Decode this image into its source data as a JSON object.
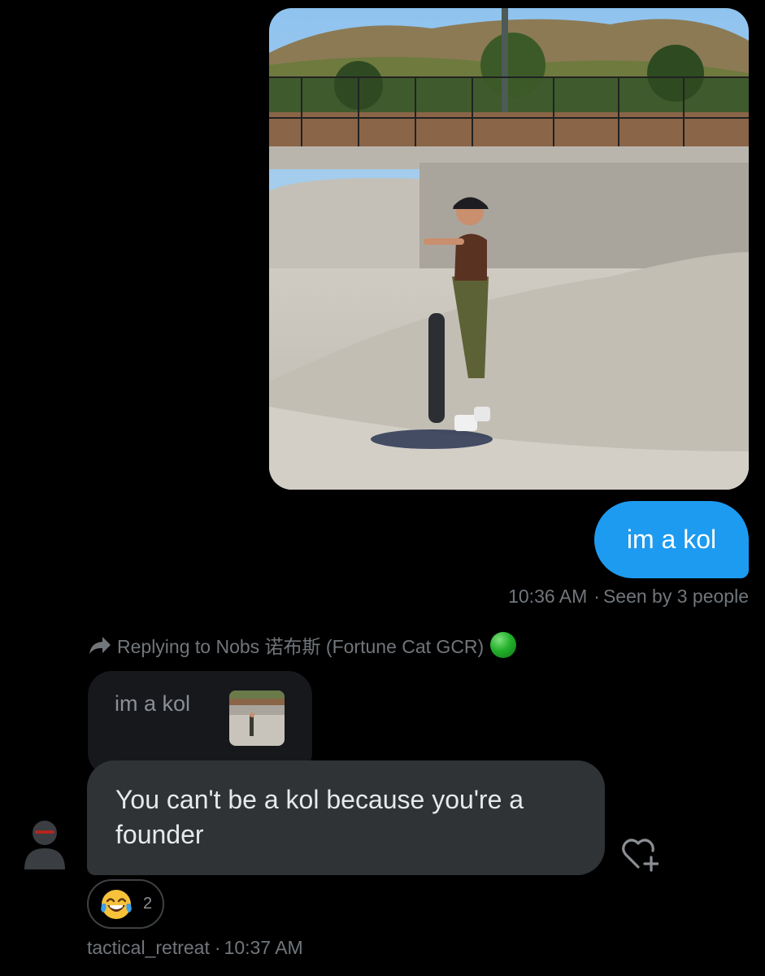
{
  "sent": {
    "image_alt": "Photo of a person holding a skateboard at a skatepark",
    "message": "im a kol",
    "time": "10:36 AM",
    "separator": "·",
    "seen": "Seen by 3 people"
  },
  "reply_header": {
    "text": "Replying to Nobs 诺布斯 (Fortune Cat GCR)",
    "emoji_icon": "green-circle-icon"
  },
  "quote": {
    "text": "im a kol"
  },
  "received": {
    "message": "You can't be a kol because you're a founder",
    "reaction": {
      "emoji_icon": "tears-of-joy-icon",
      "count": "2"
    },
    "author": "tactical_retreat",
    "separator": "·",
    "time": "10:37 AM"
  },
  "colors": {
    "background": "#000000",
    "sent_bubble": "#1d9bf0",
    "received_bubble": "#2f3336",
    "muted_text": "#71767b"
  }
}
